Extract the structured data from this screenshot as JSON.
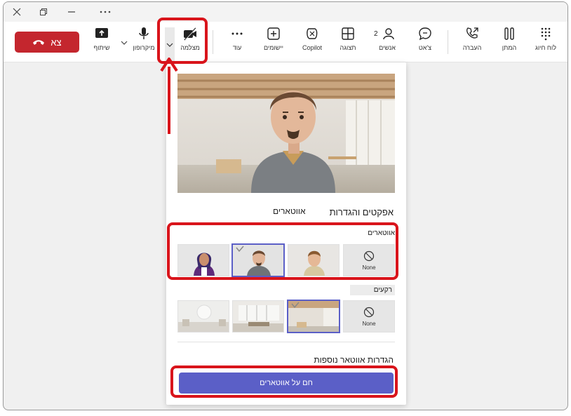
{
  "window": {
    "controls": [
      "close-icon",
      "restore-icon",
      "minimize-icon",
      "more-icon"
    ]
  },
  "toolbar": {
    "leave_label": "צא",
    "share_label": "שיתוף",
    "mic_label": "מיקרופון",
    "camera_label": "מצלמה",
    "more_label": "עוד",
    "apps_label": "יישומים",
    "copilot_label": "Copilot",
    "view_label": "תצוגה",
    "people_label": "אנשים",
    "people_count": "2",
    "chat_label": "צ'אט",
    "transfer_label": "העברה",
    "hold_label": "המתן",
    "dialpad_label": "לוח חיוג"
  },
  "panel": {
    "title": "אפקטים והגדרות",
    "tab_avatars": "אווטארים",
    "avatars_section": "אווטארים",
    "backgrounds_section": "רקעים",
    "none_label": "None",
    "more_settings": "הגדרות אווטאר נוספות",
    "avatars_button": "חם על אווטארים"
  },
  "colors": {
    "accent": "#5b5fc7",
    "leave": "#c4262e",
    "highlight": "#d9141b"
  }
}
